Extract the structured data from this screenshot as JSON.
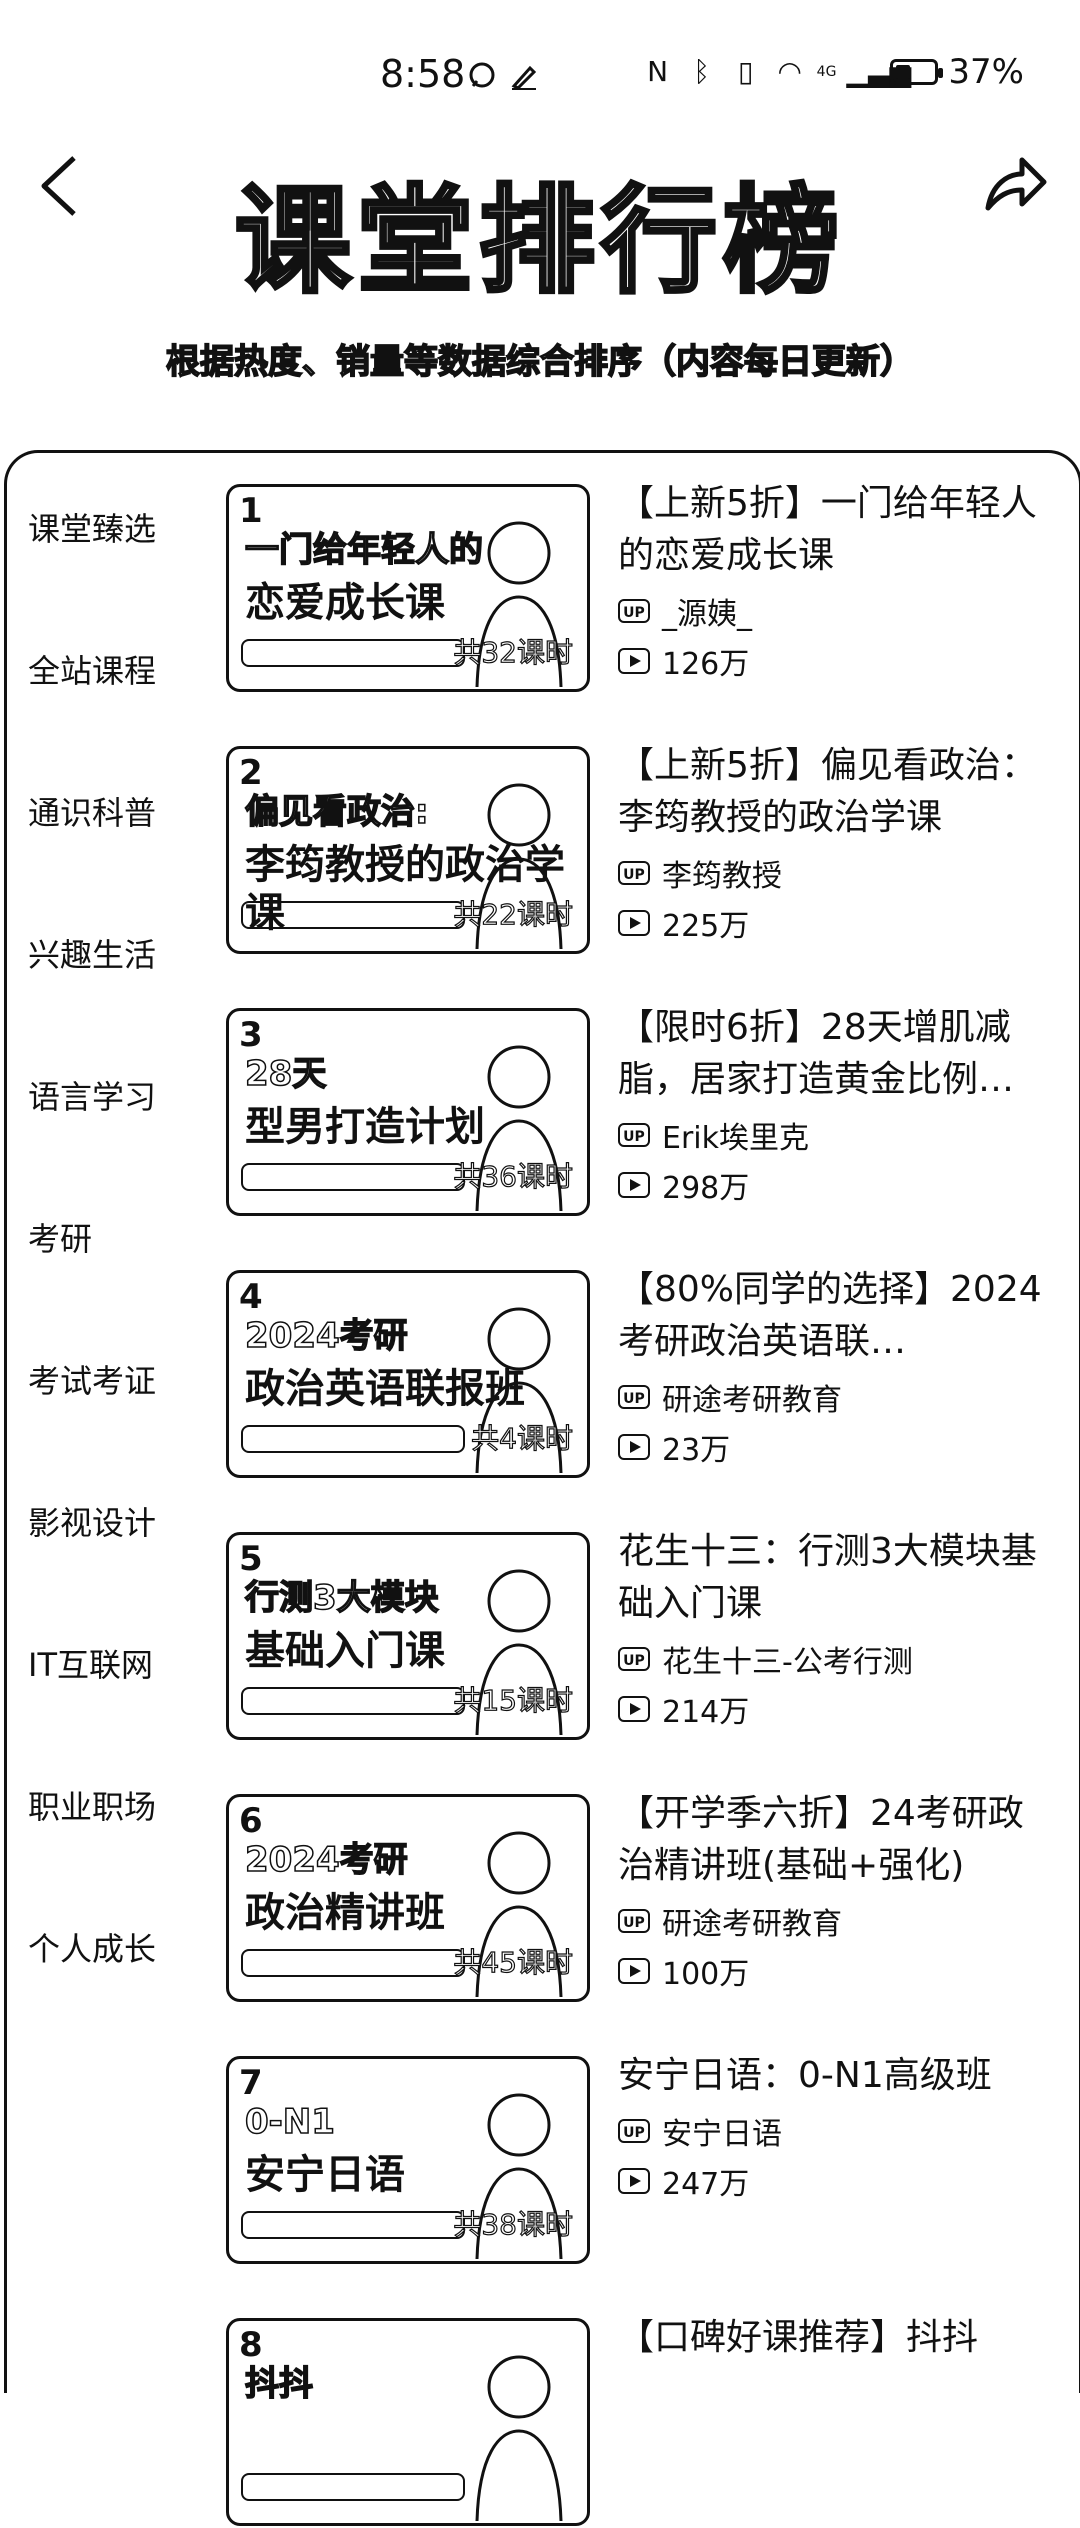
{
  "status_bar": {
    "time": "8:58",
    "network": "4G",
    "battery_percent": "37%",
    "battery_level": 0.37
  },
  "header": {
    "title": "课堂排行榜",
    "subtitle": "根据热度、销量等数据综合排序（内容每日更新）",
    "back_icon": "chevron-left-icon",
    "share_icon": "share-arrow-icon"
  },
  "sidebar": {
    "items": [
      {
        "label": "课堂臻选",
        "selected": true
      },
      {
        "label": "全站课程"
      },
      {
        "label": "通识科普"
      },
      {
        "label": "兴趣生活"
      },
      {
        "label": "语言学习"
      },
      {
        "label": "考研"
      },
      {
        "label": "考试考证"
      },
      {
        "label": "影视设计"
      },
      {
        "label": "IT互联网"
      },
      {
        "label": "职业职场"
      },
      {
        "label": "个人成长"
      }
    ]
  },
  "courses": [
    {
      "rank": "1",
      "thumb_line1": "一门给年轻人的",
      "thumb_line2": "恋爱成长课",
      "thumb_count": "共32课时",
      "title": "【上新5折】一门给年轻人的恋爱成长课",
      "author": "_源姨_",
      "views": "126万"
    },
    {
      "rank": "2",
      "thumb_line1": "偏见看政治:",
      "thumb_line2": "李筠教授的政治学课",
      "thumb_count": "共22课时",
      "title": "【上新5折】偏见看政治：李筠教授的政治学课",
      "author": "李筠教授",
      "views": "225万"
    },
    {
      "rank": "3",
      "thumb_line1": "28天",
      "thumb_line2": "型男打造计划",
      "thumb_count": "共36课时",
      "title": "【限时6折】28天增肌减脂，居家打造黄金比例…",
      "author": "Erik埃里克",
      "views": "298万"
    },
    {
      "rank": "4",
      "thumb_line1": "2024考研",
      "thumb_line2": "政治英语联报班",
      "thumb_count": "共4课时",
      "title": "【80%同学的选择】2024考研政治英语联…",
      "author": "研途考研教育",
      "views": "23万"
    },
    {
      "rank": "5",
      "thumb_line1": "行测3大模块",
      "thumb_line2": "基础入门课",
      "thumb_count": "共15课时",
      "title": "花生十三：行测3大模块基础入门课",
      "author": "花生十三-公考行测",
      "views": "214万"
    },
    {
      "rank": "6",
      "thumb_line1": "2024考研",
      "thumb_line2": "政治精讲班",
      "thumb_count": "共45课时",
      "title": "【开学季六折】24考研政治精讲班(基础+强化)",
      "author": "研途考研教育",
      "views": "100万"
    },
    {
      "rank": "7",
      "thumb_line1": "0-N1",
      "thumb_line2": "安宁日语",
      "thumb_count": "共38课时",
      "title": "安宁日语：0-N1高级班",
      "author": "安宁日语",
      "views": "247万"
    },
    {
      "rank": "8",
      "thumb_line1": "抖抖",
      "thumb_line2": "",
      "thumb_count": "",
      "title": "【口碑好课推荐】抖抖",
      "author": "",
      "views": ""
    }
  ],
  "colors": {
    "background": "#ffffff",
    "ink": "#111111"
  }
}
